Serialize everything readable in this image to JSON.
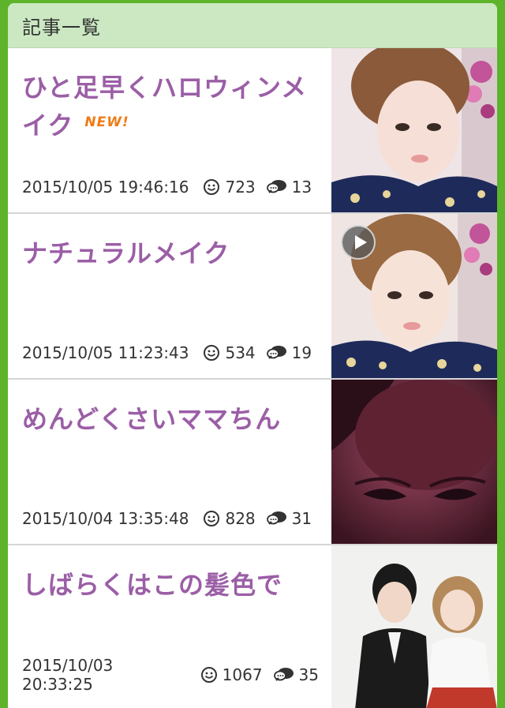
{
  "header": {
    "title": "記事一覧"
  },
  "articles": [
    {
      "title": "ひと足早くハロウィンメイク",
      "is_new": true,
      "badge": "NEW!",
      "date": "2015/10/05 19:46:16",
      "likes": "723",
      "comments": "13",
      "video": false
    },
    {
      "title": "ナチュラルメイク",
      "is_new": false,
      "badge": "",
      "date": "2015/10/05 11:23:43",
      "likes": "534",
      "comments": "19",
      "video": true
    },
    {
      "title": "めんどくさいママちん",
      "is_new": false,
      "badge": "",
      "date": "2015/10/04 13:35:48",
      "likes": "828",
      "comments": "31",
      "video": false
    },
    {
      "title": "しばらくはこの髪色で",
      "is_new": false,
      "badge": "",
      "date": "2015/10/03 20:33:25",
      "likes": "1067",
      "comments": "35",
      "video": false
    }
  ],
  "icons": {
    "likes": "smile-icon",
    "comments": "comment-icon",
    "video": "play-icon"
  },
  "colors": {
    "background": "#5db42a",
    "header": "#cbe8c2",
    "title": "#9b5ea6",
    "badge": "#f07b14"
  }
}
